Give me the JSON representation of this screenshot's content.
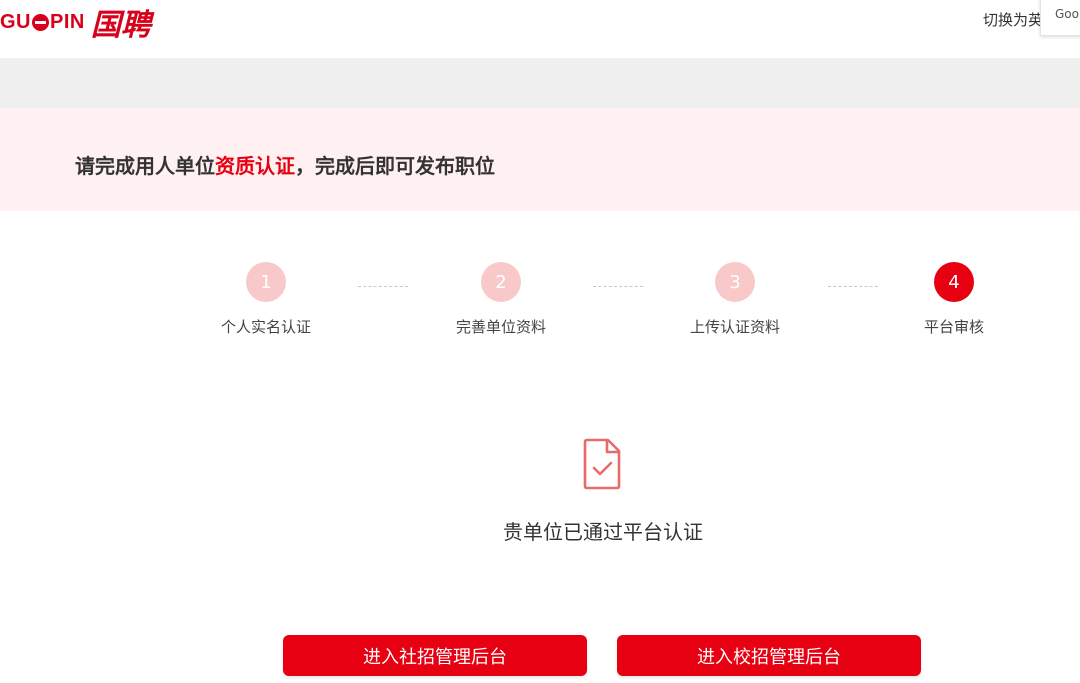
{
  "header": {
    "logo_text_a": "GU",
    "logo_text_b": "PIN",
    "logo_cn": "国聘",
    "lang_switch": "切换为英",
    "google_panel": "Goo"
  },
  "banner": {
    "prefix": "请完成用人单位",
    "highlight": "资质认证",
    "suffix": "，完成后即可发布职位"
  },
  "steps": [
    {
      "number": "1",
      "label": "个人实名认证"
    },
    {
      "number": "2",
      "label": "完善单位资料"
    },
    {
      "number": "3",
      "label": "上传认证资料"
    },
    {
      "number": "4",
      "label": "平台审核"
    }
  ],
  "result": {
    "icon": "document-check-icon",
    "message": "贵单位已通过平台认证"
  },
  "buttons": {
    "social": "进入社招管理后台",
    "campus": "进入校招管理后台"
  },
  "colors": {
    "brand_red": "#e60012",
    "step_inactive": "#f9c9c9",
    "banner_bg": "#fff1f2"
  }
}
